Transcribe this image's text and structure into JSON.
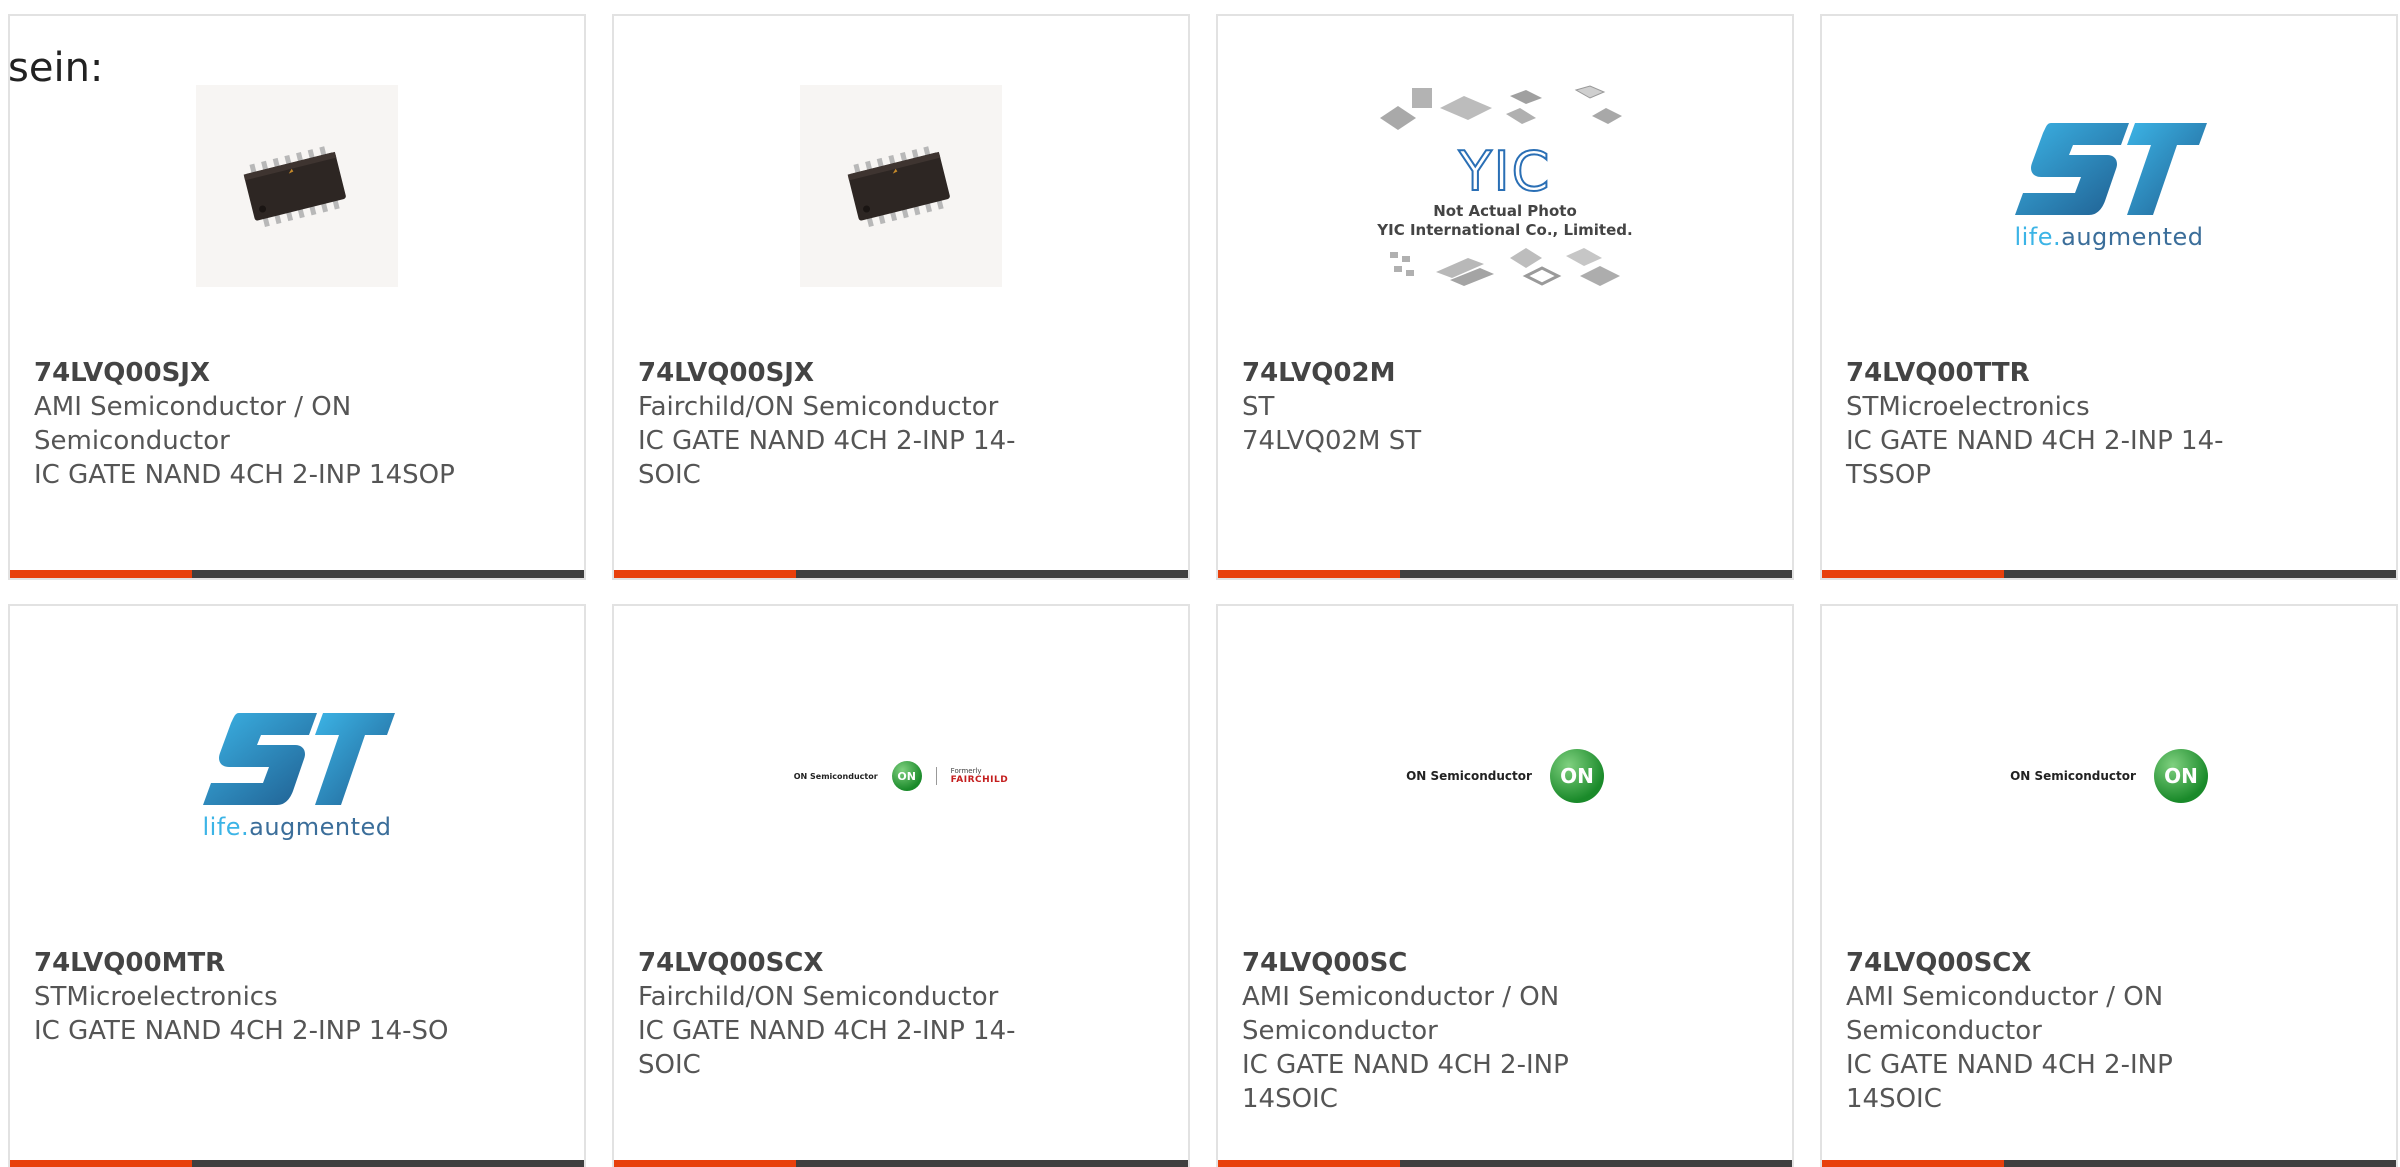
{
  "intro": {
    "text": "sein:"
  },
  "image_labels": {
    "not_actual_photo": "Not Actual Photo",
    "yic_company": "YIC International Co., Limited.",
    "yic_logo_text": "YIC",
    "st_tag_life": "life.",
    "st_tag_augmented": "augmented",
    "on_semiconductor": "ON Semiconductor",
    "on_badge": "ON",
    "formerly": "Formerly",
    "fairchild": "FAIRCHILD"
  },
  "colors": {
    "card_border": "#e2e2e2",
    "accent_bar": "#e8400c",
    "dark_bar": "#3f3f3f",
    "text": "#555555",
    "st_blue": "#3cb4e6",
    "on_green": "#1a8a2a"
  },
  "products": [
    {
      "part_number": "74LVQ00SJX",
      "manufacturer_lines": [
        "AMI Semiconductor / ON",
        "Semiconductor"
      ],
      "description_lines": [
        "IC GATE NAND 4CH 2-INP 14SOP"
      ],
      "image": "chip-photo"
    },
    {
      "part_number": "74LVQ00SJX",
      "manufacturer_lines": [
        "Fairchild/ON Semiconductor"
      ],
      "description_lines": [
        "IC GATE NAND 4CH 2-INP 14-",
        "SOIC"
      ],
      "image": "chip-photo"
    },
    {
      "part_number": "74LVQ02M",
      "manufacturer_lines": [
        "ST"
      ],
      "description_lines": [
        "74LVQ02M ST"
      ],
      "image": "yic-placeholder"
    },
    {
      "part_number": "74LVQ00TTR",
      "manufacturer_lines": [
        "STMicroelectronics"
      ],
      "description_lines": [
        "IC GATE NAND 4CH 2-INP 14-",
        "TSSOP"
      ],
      "image": "st-logo"
    },
    {
      "part_number": "74LVQ00MTR",
      "manufacturer_lines": [
        "STMicroelectronics"
      ],
      "description_lines": [
        "IC GATE NAND 4CH 2-INP 14-SO"
      ],
      "image": "st-logo"
    },
    {
      "part_number": "74LVQ00SCX",
      "manufacturer_lines": [
        "Fairchild/ON Semiconductor"
      ],
      "description_lines": [
        "IC GATE NAND 4CH 2-INP 14-",
        "SOIC"
      ],
      "image": "on-fairchild-logo"
    },
    {
      "part_number": "74LVQ00SC",
      "manufacturer_lines": [
        "AMI Semiconductor / ON",
        "Semiconductor"
      ],
      "description_lines": [
        "IC GATE NAND 4CH 2-INP",
        "14SOIC"
      ],
      "image": "on-logo"
    },
    {
      "part_number": "74LVQ00SCX",
      "manufacturer_lines": [
        "AMI Semiconductor / ON",
        "Semiconductor"
      ],
      "description_lines": [
        "IC GATE NAND 4CH 2-INP",
        "14SOIC"
      ],
      "image": "on-logo"
    }
  ]
}
